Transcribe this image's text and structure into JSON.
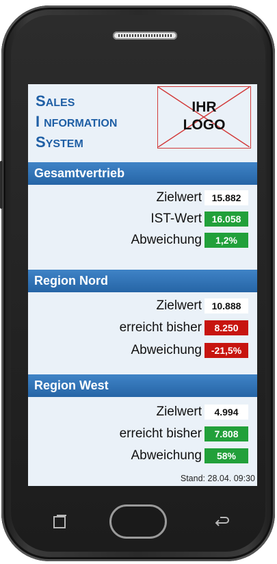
{
  "brand": {
    "line1_initial": "S",
    "line1_rest": "ALES",
    "line2_initial": "I",
    "line2_rest": "NFORMATION",
    "line3_initial": "S",
    "line3_rest": "YSTEM"
  },
  "logo": {
    "line1": "IHR",
    "line2": "LOGO"
  },
  "sections": [
    {
      "title": "Gesamtvertrieb",
      "rows": [
        {
          "label": "Zielwert",
          "value": "15.882",
          "status": "neutral"
        },
        {
          "label": "IST-Wert",
          "value": "16.058",
          "status": "positive"
        },
        {
          "label": "Abweichung",
          "value": "1,2%",
          "status": "positive"
        }
      ]
    },
    {
      "title": "Region Nord",
      "rows": [
        {
          "label": "Zielwert",
          "value": "10.888",
          "status": "neutral"
        },
        {
          "label": "erreicht bisher",
          "value": "8.250",
          "status": "negative"
        },
        {
          "label": "Abweichung",
          "value": "-21,5%",
          "status": "negative"
        }
      ]
    },
    {
      "title": "Region West",
      "rows": [
        {
          "label": "Zielwert",
          "value": "4.994",
          "status": "neutral"
        },
        {
          "label": "erreicht bisher",
          "value": "7.808",
          "status": "positive"
        },
        {
          "label": "Abweichung",
          "value": "58%",
          "status": "positive"
        }
      ]
    }
  ],
  "footer": {
    "stand": "Stand: 28.04. 09:30"
  },
  "colors": {
    "brand_blue": "#1f5fa5",
    "section_blue": "#2d70b4",
    "positive": "#22a03a",
    "negative": "#c7150f",
    "screen_bg": "#eaf1f8"
  },
  "icons": [
    "recent-apps-icon",
    "home-button",
    "back-icon"
  ]
}
